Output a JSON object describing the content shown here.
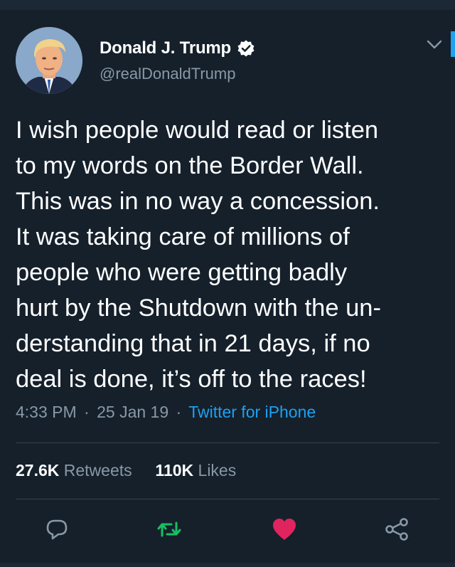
{
  "author": {
    "display_name": "Donald J. Trump",
    "handle": "@realDonaldTrump",
    "verified_icon": "verified-badge-icon"
  },
  "tweet": {
    "lines": [
      "I wish people would read or listen",
      "to my words on the Border Wall.",
      "This was in no way a concession.",
      "It was taking care of millions of",
      "people who were getting badly",
      "hurt by the Shutdown with the un-",
      "derstanding that in 21 days, if no",
      "deal is done, it’s off to the races!"
    ],
    "time": "4:33 PM",
    "date": "25 Jan 19",
    "source": "Twitter for iPhone",
    "separator": "·"
  },
  "stats": {
    "retweets_count": "27.6K",
    "retweets_label": "Retweets",
    "likes_count": "110K",
    "likes_label": "Likes"
  },
  "actions": {
    "reply": "reply-icon",
    "retweet": "retweet-icon",
    "like": "heart-icon",
    "share": "share-icon"
  },
  "colors": {
    "background": "#15202b",
    "accent": "#1da1f2",
    "retweet_green": "#17bf63",
    "like_red": "#e0245e",
    "secondary_text": "#8899a6"
  }
}
